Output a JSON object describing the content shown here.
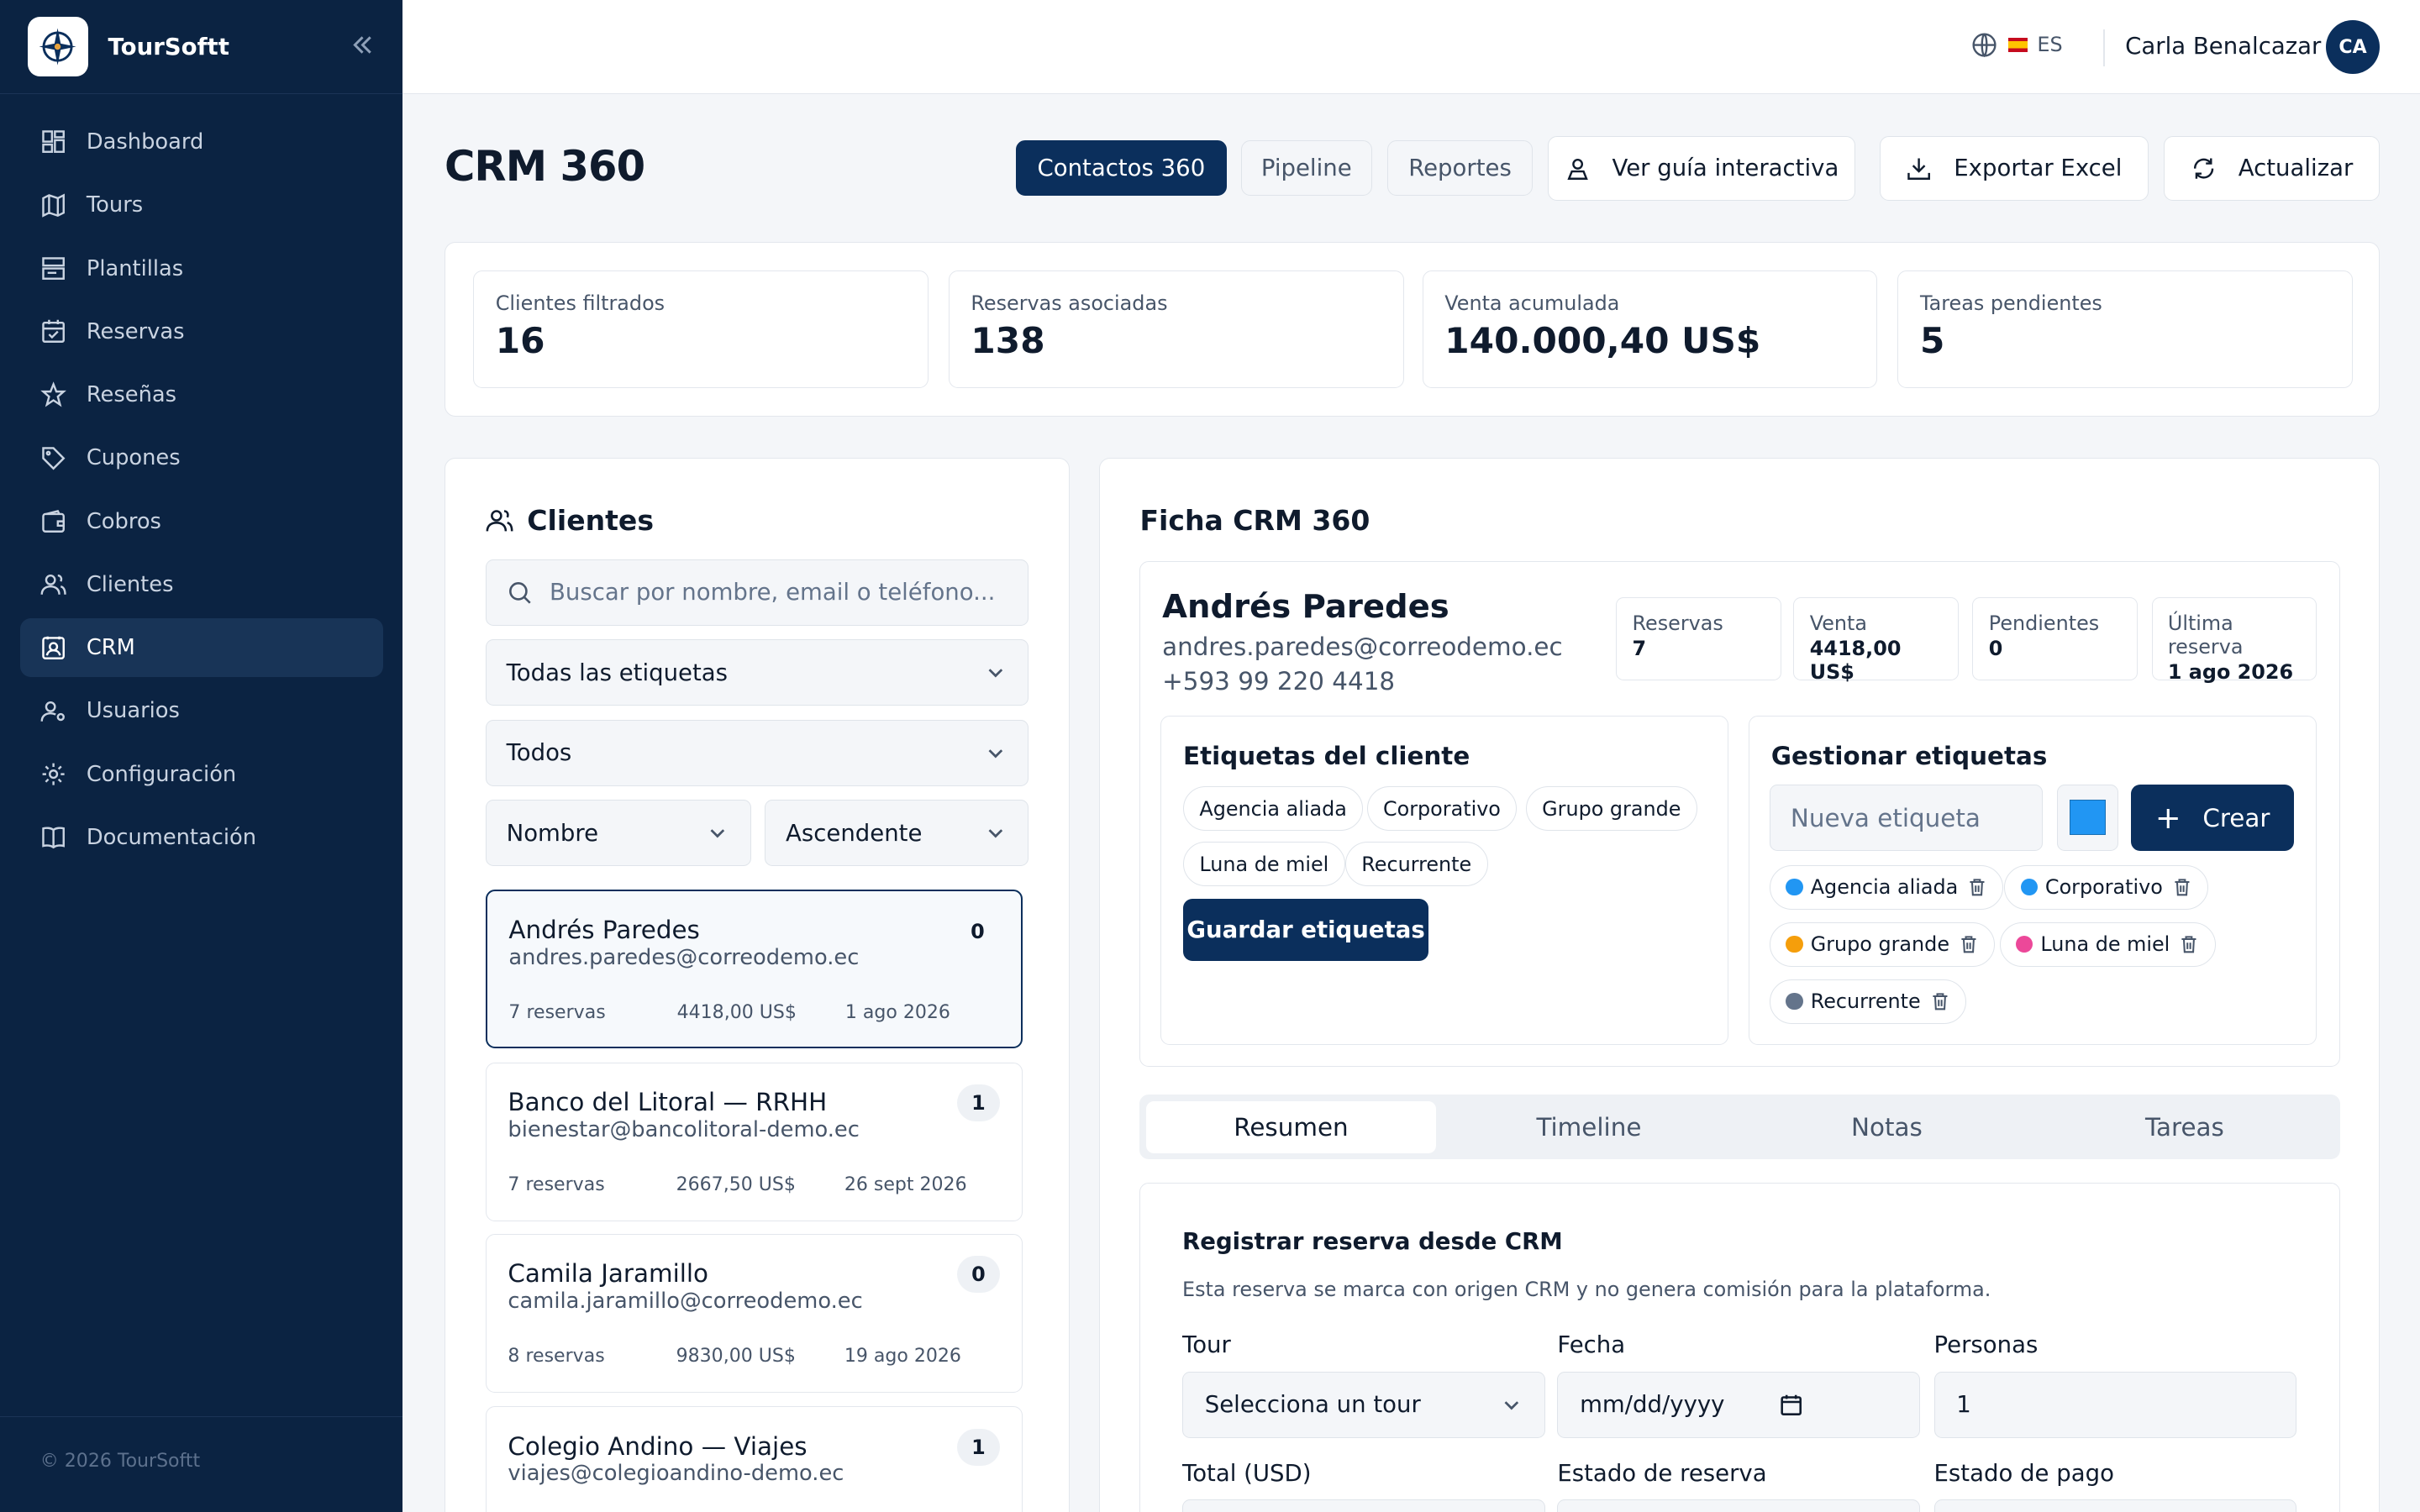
{
  "brand": {
    "name": "TourSoftt"
  },
  "sidebar": {
    "items": [
      {
        "label": "Dashboard",
        "icon": "dashboard-icon"
      },
      {
        "label": "Tours",
        "icon": "map-icon"
      },
      {
        "label": "Plantillas",
        "icon": "template-icon"
      },
      {
        "label": "Reservas",
        "icon": "calendar-icon"
      },
      {
        "label": "Reseñas",
        "icon": "star-icon"
      },
      {
        "label": "Cupones",
        "icon": "tag-icon"
      },
      {
        "label": "Cobros",
        "icon": "wallet-icon"
      },
      {
        "label": "Clientes",
        "icon": "users-icon"
      },
      {
        "label": "CRM",
        "icon": "contact-icon"
      },
      {
        "label": "Usuarios",
        "icon": "user-gear-icon"
      },
      {
        "label": "Configuración",
        "icon": "gear-icon"
      },
      {
        "label": "Documentación",
        "icon": "book-icon"
      }
    ],
    "active": "CRM",
    "footer": "© 2026 TourSoftt"
  },
  "topbar": {
    "lang": "ES",
    "user": "Carla Benalcazar",
    "initials": "CA"
  },
  "header": {
    "title": "CRM 360",
    "tabs": [
      "Contactos 360",
      "Pipeline",
      "Reportes"
    ],
    "guide": "Ver guía interactiva",
    "export": "Exportar Excel",
    "refresh": "Actualizar"
  },
  "kpis": [
    {
      "label": "Clientes filtrados",
      "value": "16"
    },
    {
      "label": "Reservas asociadas",
      "value": "138"
    },
    {
      "label": "Venta acumulada",
      "value": "140.000,40 US$"
    },
    {
      "label": "Tareas pendientes",
      "value": "5"
    }
  ],
  "clients": {
    "title": "Clientes",
    "search_placeholder": "Buscar por nombre, email o teléfono...",
    "tag_filter": "Todas las etiquetas",
    "status_filter": "Todos",
    "sort_by": "Nombre",
    "sort_dir": "Ascendente",
    "list": [
      {
        "name": "Andrés Paredes",
        "email": "andres.paredes@correodemo.ec",
        "badge": "0",
        "reservas": "7 reservas",
        "venta": "4418,00 US$",
        "fecha": "1 ago 2026"
      },
      {
        "name": "Banco del Litoral — RRHH",
        "email": "bienestar@bancolitoral-demo.ec",
        "badge": "1",
        "reservas": "7 reservas",
        "venta": "2667,50 US$",
        "fecha": "26 sept 2026"
      },
      {
        "name": "Camila Jaramillo",
        "email": "camila.jaramillo@correodemo.ec",
        "badge": "0",
        "reservas": "8 reservas",
        "venta": "9830,00 US$",
        "fecha": "19 ago 2026"
      },
      {
        "name": "Colegio Andino — Viajes",
        "email": "viajes@colegioandino-demo.ec",
        "badge": "1",
        "reservas": "",
        "venta": "",
        "fecha": ""
      }
    ]
  },
  "ficha": {
    "title": "Ficha CRM 360",
    "name": "Andrés Paredes",
    "email": "andres.paredes@correodemo.ec",
    "phone": "+593 99 220 4418",
    "stats": [
      {
        "label": "Reservas",
        "value": "7"
      },
      {
        "label": "Venta",
        "value": "4418,00 US$"
      },
      {
        "label": "Pendientes",
        "value": "0"
      },
      {
        "label": "Última reserva",
        "value": "1 ago 2026"
      }
    ],
    "tags_title": "Etiquetas del cliente",
    "client_tags": [
      "Agencia aliada",
      "Corporativo",
      "Grupo grande",
      "Luna de miel",
      "Recurrente"
    ],
    "save_label": "Guardar etiquetas",
    "manage_title": "Gestionar etiquetas",
    "new_tag_placeholder": "Nueva etiqueta",
    "new_tag_color": "#2196f3",
    "create_label": "Crear",
    "managed_tags": [
      {
        "label": "Agencia aliada",
        "color": "#2196f3"
      },
      {
        "label": "Corporativo",
        "color": "#2196f3"
      },
      {
        "label": "Grupo grande",
        "color": "#f59e0b"
      },
      {
        "label": "Luna de miel",
        "color": "#ec4899"
      },
      {
        "label": "Recurrente",
        "color": "#64748b"
      }
    ],
    "tabs": [
      "Resumen",
      "Timeline",
      "Notas",
      "Tareas"
    ],
    "register": {
      "title": "Registrar reserva desde CRM",
      "subtitle": "Esta reserva se marca con origen CRM y no genera comisión para la plataforma.",
      "tour_label": "Tour",
      "tour_value": "Selecciona un tour",
      "date_label": "Fecha",
      "date_value": "mm/dd/yyyy",
      "people_label": "Personas",
      "people_value": "1",
      "total_label": "Total (USD)",
      "estado_reserva_label": "Estado de reserva",
      "estado_pago_label": "Estado de pago"
    }
  }
}
